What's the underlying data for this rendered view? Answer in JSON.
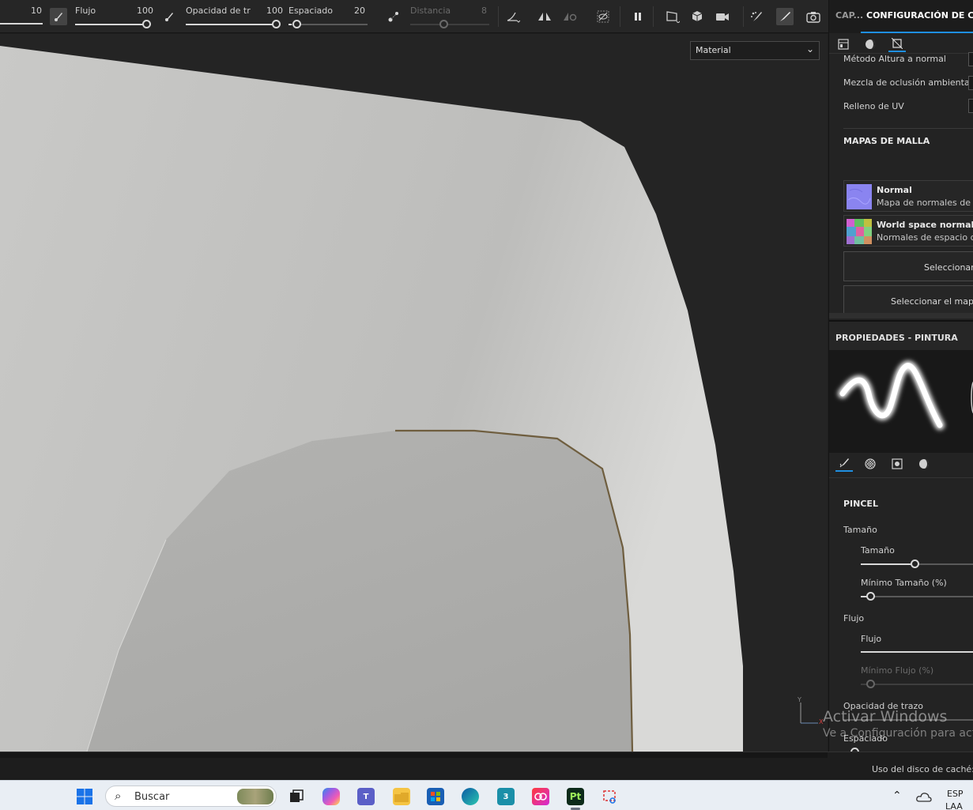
{
  "toolbar": {
    "size_value": "10",
    "flow_label": "Flujo",
    "flow_value": "100",
    "opacity_label": "Opacidad de tr",
    "opacity_value": "100",
    "spacing_label": "Espaciado",
    "spacing_value": "20",
    "distance_label": "Distancia",
    "distance_value": "8",
    "flow_level": 1.0,
    "opacity_level": 1.0,
    "spacing_level": 0.02,
    "distance_level": 0.43
  },
  "viewport": {
    "material_select": "Material",
    "axis_y": "Y",
    "axis_x": "X"
  },
  "panel": {
    "tab_short": "CAP...",
    "tab_active": "CONFIGURACIÓN DE CON",
    "props": [
      "Método Altura a normal",
      "Mezcla de oclusión ambiental",
      "Relleno de UV"
    ],
    "mesh_maps_title": "MAPAS DE MALLA",
    "maps": [
      {
        "title": "Normal",
        "subtitle": "Mapa de normales de m"
      },
      {
        "title": "World space normal",
        "subtitle": "Normales de espacio de"
      }
    ],
    "select_btn_1": "Seleccionar",
    "select_btn_2": "Seleccionar el mapa"
  },
  "paint": {
    "title": "PROPIEDADES - PINTURA",
    "brush_title": "PINCEL",
    "size_group": "Tamaño",
    "size_label": "Tamaño",
    "size_level": 0.45,
    "min_size_label": "Mínimo Tamaño (%)",
    "min_size_level": 0.08,
    "flow_group": "Flujo",
    "flow_label": "Flujo",
    "flow_level": 1.0,
    "min_flow_label": "Mínimo Flujo (%)",
    "min_flow_level": 0.08,
    "opacity_label": "Opacidad de trazo",
    "spacing_label": "Espaciado",
    "spacing_level": 0.08
  },
  "watermark": {
    "line1": "Activar Windows",
    "line2": "Ve a Configuración para activ"
  },
  "status": {
    "cache_label": "Uso del disco de caché:"
  },
  "taskbar": {
    "search_label": "Buscar",
    "lang_top": "ESP",
    "lang_bottom": "LAA",
    "pt_label": "Pt",
    "max_label": "3"
  }
}
